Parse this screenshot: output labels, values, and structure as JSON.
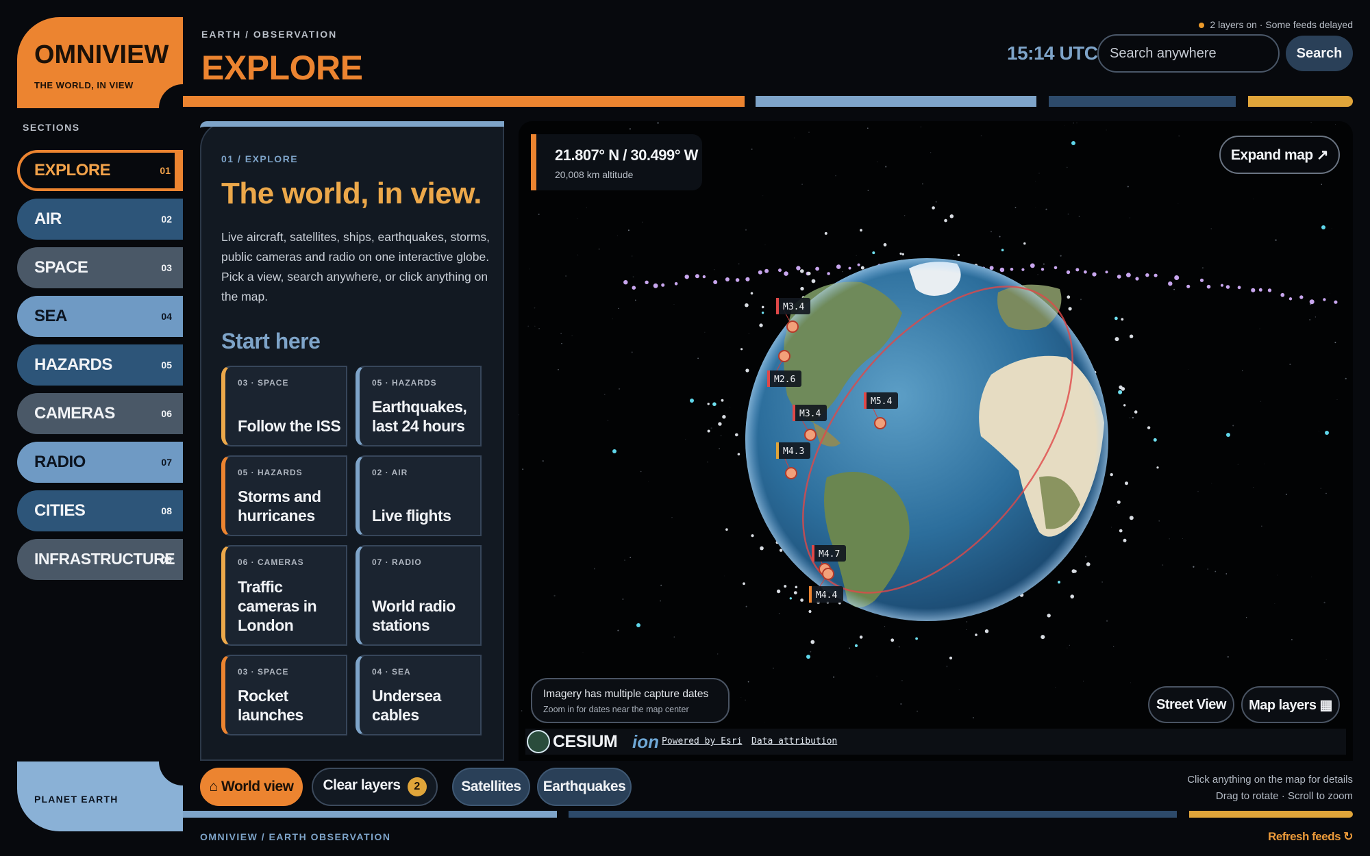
{
  "brand": {
    "name": "OMNIVIEW",
    "tagline": "THE WORLD, IN VIEW"
  },
  "sidebar": {
    "heading": "SECTIONS",
    "items": [
      {
        "label": "EXPLORE",
        "num": "01",
        "color": "#07090d",
        "active": true
      },
      {
        "label": "AIR",
        "num": "02",
        "color": "#2d5579"
      },
      {
        "label": "SPACE",
        "num": "03",
        "color": "#4a5867"
      },
      {
        "label": "SEA",
        "num": "04",
        "color": "#6f9ac4"
      },
      {
        "label": "HAZARDS",
        "num": "05",
        "color": "#2d5579"
      },
      {
        "label": "CAMERAS",
        "num": "06",
        "color": "#4a5867"
      },
      {
        "label": "RADIO",
        "num": "07",
        "color": "#6f9ac4"
      },
      {
        "label": "CITIES",
        "num": "08",
        "color": "#2d5579"
      },
      {
        "label": "INFRASTRUCTURE",
        "num": "09",
        "color": "#4a5867"
      }
    ],
    "footer_label": "PLANET EARTH"
  },
  "header": {
    "breadcrumb": "EARTH / OBSERVATION",
    "title": "EXPLORE",
    "status": "2 layers on · Some feeds delayed",
    "clock": "15:14 UTC",
    "search_placeholder": "Search anywhere",
    "search_button": "Search"
  },
  "panel": {
    "crumb": "01 / EXPLORE",
    "heading": "The world, in view.",
    "description": "Live aircraft, satellites, ships, earthquakes, storms, public cameras and radio on one interactive globe. Pick a view, search anywhere, or click anything on the map.",
    "start_here": "Start here",
    "cards": [
      {
        "category": "03 · SPACE",
        "title": "Follow the ISS",
        "accent": "#eca84a"
      },
      {
        "category": "05 · HAZARDS",
        "title": "Earthquakes, last 24 hours",
        "accent": "#7ea4c9"
      },
      {
        "category": "05 · HAZARDS",
        "title": "Storms and hurricanes",
        "accent": "#ec8430"
      },
      {
        "category": "02 · AIR",
        "title": "Live flights",
        "accent": "#7ea4c9"
      },
      {
        "category": "06 · CAMERAS",
        "title": "Traffic cameras in London",
        "accent": "#eca84a"
      },
      {
        "category": "07 · RADIO",
        "title": "World radio stations",
        "accent": "#7ea4c9"
      },
      {
        "category": "03 · SPACE",
        "title": "Rocket launches",
        "accent": "#ec8430"
      },
      {
        "category": "04 · SEA",
        "title": "Undersea cables",
        "accent": "#7ea4c9"
      }
    ]
  },
  "map": {
    "coords": "21.807° N / 30.499° W",
    "altitude": "20,008 km altitude",
    "expand_button": "Expand map ↗",
    "imagery_title": "Imagery has multiple capture dates",
    "imagery_sub": "Zoom in for dates near the map center",
    "street_view": "Street View",
    "map_layers": "Map layers ▦",
    "quake_labels": [
      "M3.4",
      "M2.6",
      "M3.4",
      "M5.4",
      "M4.3",
      "M4.7",
      "M4.4"
    ],
    "attribution": {
      "cesium": "CESIUM",
      "ion": "ion",
      "powered": "Powered by Esri",
      "data": "Data attribution"
    }
  },
  "bottom": {
    "world_view": "⌂ World view",
    "clear_layers": "Clear layers",
    "clear_count": "2",
    "satellites": "Satellites",
    "earthquakes": "Earthquakes",
    "hint_1": "Click anything on the map for details",
    "hint_2": "Drag to rotate · Scroll to zoom",
    "footer_crumb": "OMNIVIEW / EARTH OBSERVATION",
    "refresh": "Refresh feeds ↻"
  },
  "colors": {
    "accent": "#ec8430",
    "gold": "#eca84a",
    "steel": "#7ea4c9",
    "navy": "#2d5579"
  }
}
